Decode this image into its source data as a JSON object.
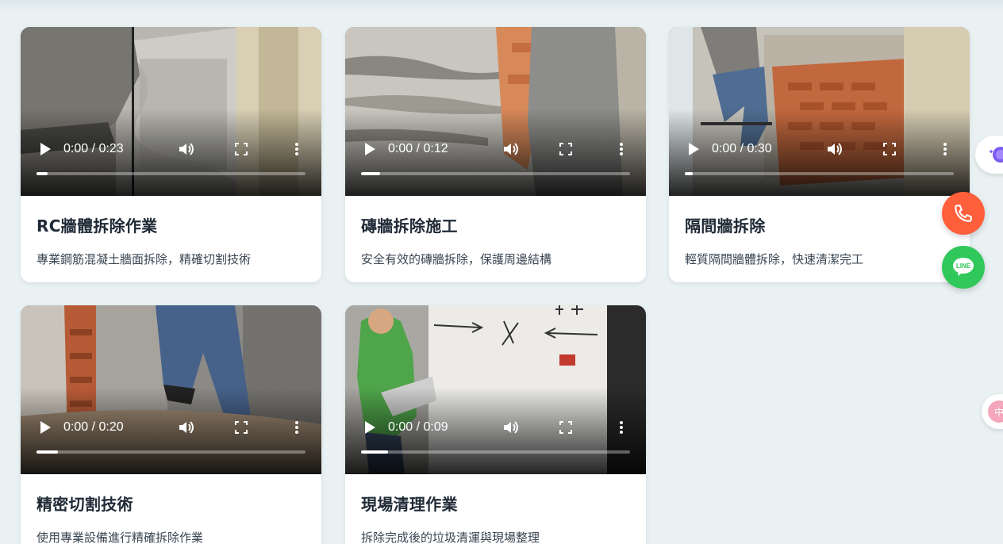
{
  "cards": [
    {
      "title": "RC牆體拆除作業",
      "description": "專業鋼筋混凝土牆面拆除，精確切割技術",
      "time": "0:00 / 0:23",
      "progress": 0.04
    },
    {
      "title": "磚牆拆除施工",
      "description": "安全有效的磚牆拆除，保護周邊結構",
      "time": "0:00 / 0:12",
      "progress": 0.07
    },
    {
      "title": "隔間牆拆除",
      "description": "輕質隔間牆體拆除，快速清潔完工",
      "time": "0:00 / 0:30",
      "progress": 0.03
    },
    {
      "title": "精密切割技術",
      "description": "使用專業設備進行精確拆除作業",
      "time": "0:00 / 0:20",
      "progress": 0.08
    },
    {
      "title": "現場清理作業",
      "description": "拆除完成後的垃圾清運與現場整理",
      "time": "0:00 / 0:09",
      "progress": 0.1
    }
  ],
  "floating": {
    "line_label": "LINE",
    "phone_icon": "phone-icon",
    "line_icon": "line-chat-icon",
    "phone_color": "#ff5f3a",
    "line_color": "#30c85a"
  },
  "icons": {
    "play": "play-icon",
    "volume": "volume-icon",
    "fullscreen": "fullscreen-icon",
    "more": "more-vertical-icon"
  }
}
